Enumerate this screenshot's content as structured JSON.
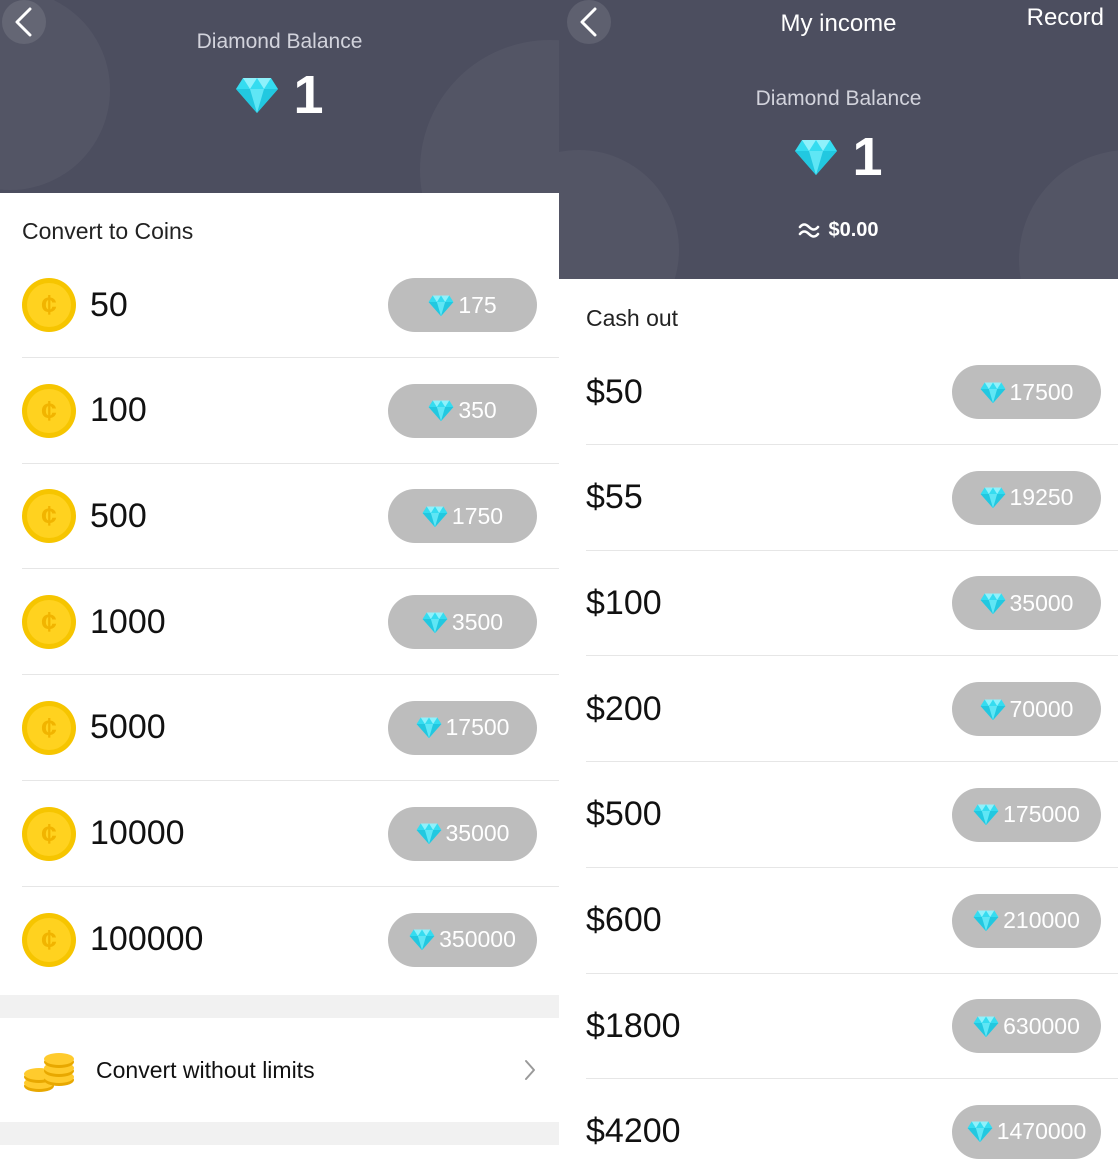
{
  "colors": {
    "header_bg": "#4c4e5f",
    "pill_bg": "#bdbdbd",
    "diamond": "#35dcf0",
    "coin": "#f6c500",
    "divider": "#e6e6e6"
  },
  "icons": {
    "back": "chevron-left-icon",
    "diamond": "diamond-icon",
    "coin": "coin-icon",
    "approx": "approx-icon",
    "coins_stack": "coin-stack-icon",
    "chevron": "chevron-right-icon"
  },
  "left": {
    "header": {
      "balance_label": "Diamond Balance",
      "balance_value": "1"
    },
    "section_title": "Convert to Coins",
    "coin_symbol": "¢",
    "rows": [
      {
        "amount": "50",
        "cost": "175"
      },
      {
        "amount": "100",
        "cost": "350"
      },
      {
        "amount": "500",
        "cost": "1750"
      },
      {
        "amount": "1000",
        "cost": "3500"
      },
      {
        "amount": "5000",
        "cost": "17500"
      },
      {
        "amount": "10000",
        "cost": "35000"
      },
      {
        "amount": "100000",
        "cost": "350000"
      }
    ],
    "promo": {
      "label": "Convert without limits"
    }
  },
  "right": {
    "header": {
      "title": "My income",
      "record_label": "Record",
      "balance_label": "Diamond Balance",
      "balance_value": "1",
      "approx_value": "$0.00"
    },
    "section_title": "Cash out",
    "rows": [
      {
        "amount": "$50",
        "cost": "17500"
      },
      {
        "amount": "$55",
        "cost": "19250"
      },
      {
        "amount": "$100",
        "cost": "35000"
      },
      {
        "amount": "$200",
        "cost": "70000"
      },
      {
        "amount": "$500",
        "cost": "175000"
      },
      {
        "amount": "$600",
        "cost": "210000"
      },
      {
        "amount": "$1800",
        "cost": "630000"
      },
      {
        "amount": "$4200",
        "cost": "1470000"
      }
    ]
  }
}
